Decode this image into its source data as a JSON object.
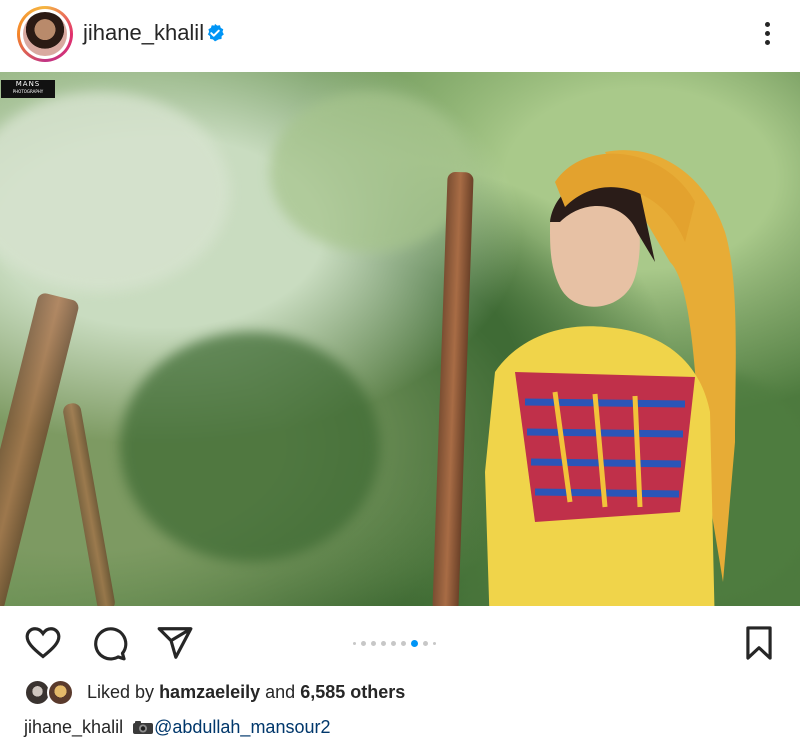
{
  "post": {
    "username": "jihane_khalil",
    "verified": true,
    "more_icon": "more-vertical-icon",
    "watermark": "MANS",
    "watermark_sub": "PHOTOGRAPHY"
  },
  "carousel": {
    "count": 9,
    "active_index": 6
  },
  "actions": {
    "like_icon": "heart-icon",
    "comment_icon": "comment-icon",
    "share_icon": "send-icon",
    "save_icon": "bookmark-icon"
  },
  "likes": {
    "prefix": "Liked by",
    "user": "hamzaeleily",
    "joiner": "and",
    "others": "6,585 others"
  },
  "caption": {
    "user": "jihane_khalil",
    "camera_emoji": "camera-emoji",
    "mention": "@abdullah_mansour2"
  },
  "colors": {
    "accent": "#0095f6",
    "verified": "#0095f6",
    "mention": "#00376b",
    "text": "#262626"
  }
}
